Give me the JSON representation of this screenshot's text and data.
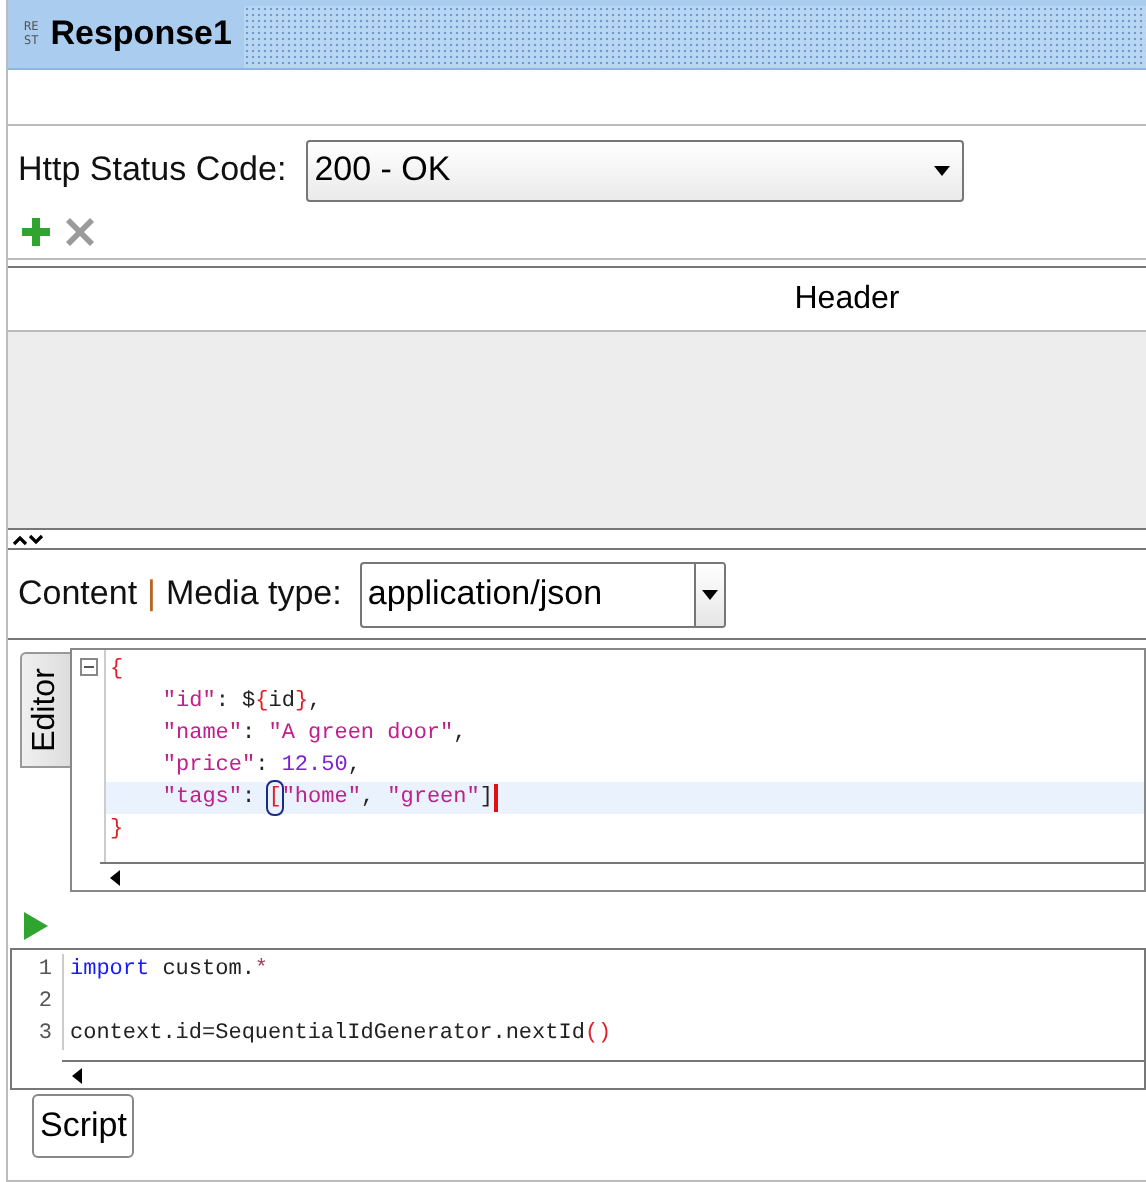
{
  "window": {
    "title": "Response1",
    "icon_text": [
      "RE",
      "ST"
    ]
  },
  "status": {
    "label": "Http Status Code:",
    "value": "200 - OK"
  },
  "header_table": {
    "columns": [
      "Header"
    ]
  },
  "content": {
    "label": "Content",
    "separator": "|",
    "media_label": "Media type:",
    "media_value": "application/json"
  },
  "editor": {
    "tab": "Editor",
    "lines": [
      {
        "current": false,
        "caret": false,
        "tokens": [
          {
            "kind": "brace",
            "text": "{"
          }
        ]
      },
      {
        "current": false,
        "caret": false,
        "tokens": [
          {
            "kind": "string",
            "text": "    \"id\""
          },
          {
            "kind": "plain",
            "text": ": $"
          },
          {
            "kind": "brace",
            "text": "{"
          },
          {
            "kind": "plain",
            "text": "id"
          },
          {
            "kind": "brace",
            "text": "}"
          },
          {
            "kind": "plain",
            "text": ","
          }
        ]
      },
      {
        "current": false,
        "caret": false,
        "tokens": [
          {
            "kind": "string",
            "text": "    \"name\""
          },
          {
            "kind": "plain",
            "text": ": "
          },
          {
            "kind": "string",
            "text": "\"A green door\""
          },
          {
            "kind": "plain",
            "text": ","
          }
        ]
      },
      {
        "current": false,
        "caret": false,
        "tokens": [
          {
            "kind": "string",
            "text": "    \"price\""
          },
          {
            "kind": "plain",
            "text": ": "
          },
          {
            "kind": "number",
            "text": "12.50"
          },
          {
            "kind": "plain",
            "text": ","
          }
        ]
      },
      {
        "current": true,
        "caret": true,
        "tokens": [
          {
            "kind": "string",
            "text": "    \"tags\""
          },
          {
            "kind": "plain",
            "text": ": "
          },
          {
            "kind": "matched",
            "text": "["
          },
          {
            "kind": "string",
            "text": "\"home\""
          },
          {
            "kind": "plain",
            "text": ", "
          },
          {
            "kind": "string",
            "text": "\"green\""
          },
          {
            "kind": "plain",
            "text": "]"
          }
        ]
      },
      {
        "current": false,
        "caret": false,
        "tokens": [
          {
            "kind": "brace",
            "text": "}"
          }
        ]
      }
    ]
  },
  "script": {
    "tab": "Script",
    "lines": [
      {
        "number": "1",
        "tokens": [
          {
            "kind": "keyword",
            "text": "import"
          },
          {
            "kind": "plain",
            "text": " custom."
          },
          {
            "kind": "operator",
            "text": "*"
          }
        ]
      },
      {
        "number": "2"
      },
      {
        "number": "3",
        "tokens": [
          {
            "kind": "plain",
            "text": "context.id=SequentialIdGenerator.nextId"
          },
          {
            "kind": "brace",
            "text": "()"
          }
        ]
      }
    ]
  }
}
